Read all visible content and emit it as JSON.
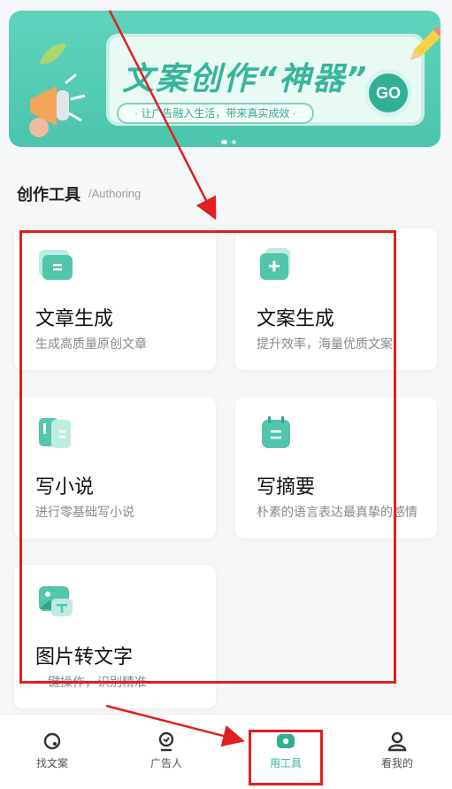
{
  "banner": {
    "title": "文案创作“神器”",
    "slogan": "· 让广告融入生活，带来真实成效 ·",
    "go_label": "GO"
  },
  "section": {
    "title": "创作工具",
    "subtitle": "/Authoring"
  },
  "tools": [
    {
      "title": "文章生成",
      "desc": "生成高质量原创文章",
      "icon": "folder-icon"
    },
    {
      "title": "文案生成",
      "desc": "提升效率，海量优质文案",
      "icon": "add-document-icon"
    },
    {
      "title": "写小说",
      "desc": "进行零基础写小说",
      "icon": "book-icon"
    },
    {
      "title": "写摘要",
      "desc": "朴素的语言表达最真挚的感情",
      "icon": "notepad-icon"
    },
    {
      "title": "图片转文字",
      "desc": "一键操作，识别精准",
      "icon": "image-text-icon"
    }
  ],
  "nav": [
    {
      "label": "找文案",
      "icon": "search-icon"
    },
    {
      "label": "广告人",
      "icon": "advertiser-icon"
    },
    {
      "label": "用工具",
      "icon": "tools-icon"
    },
    {
      "label": "看我的",
      "icon": "user-icon"
    }
  ],
  "colors": {
    "accent": "#2fb095",
    "banner": "#4cc5ad",
    "annotation": "#e02020"
  }
}
